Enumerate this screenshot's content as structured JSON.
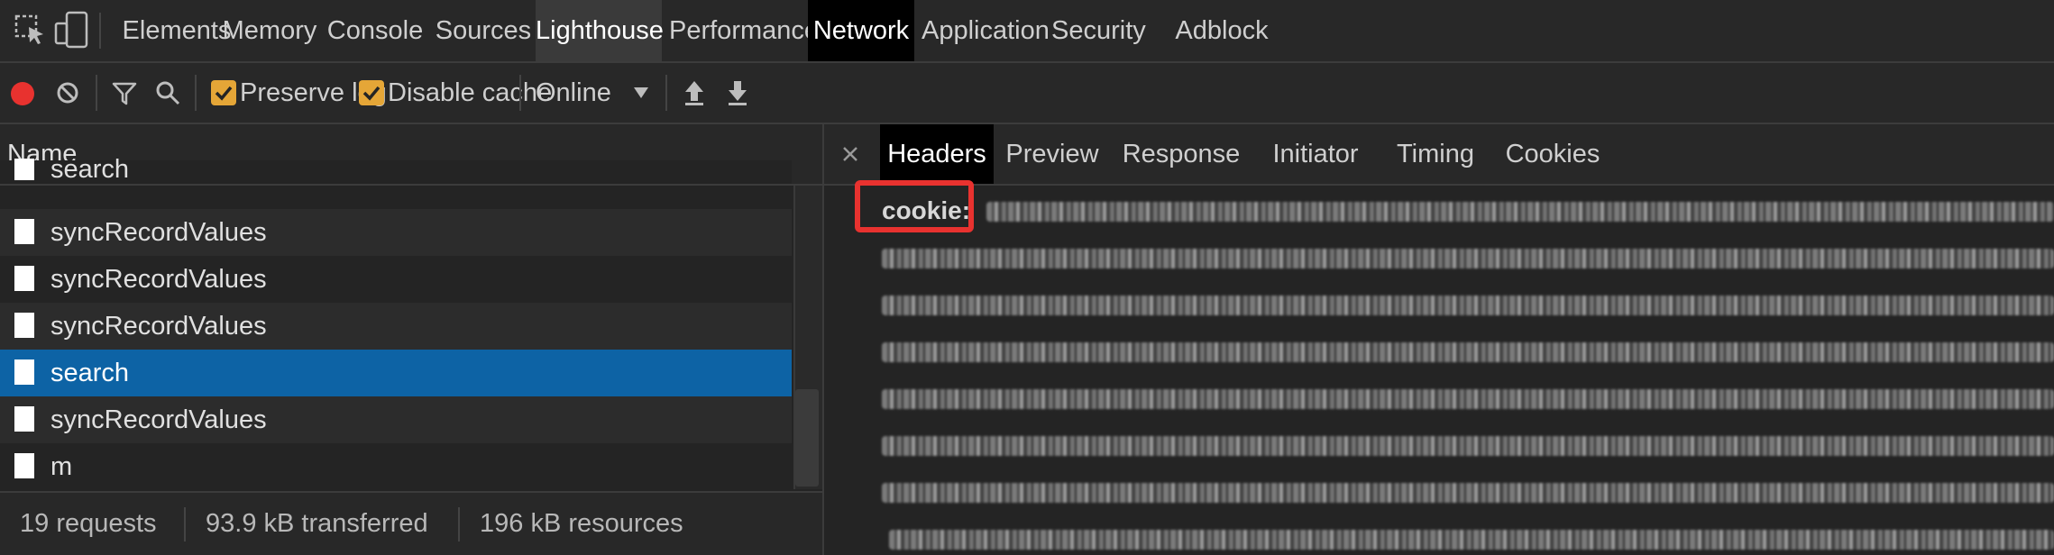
{
  "top_tabs": [
    "Elements",
    "Memory",
    "Console",
    "Sources",
    "Lighthouse",
    "Performance",
    "Network",
    "Application",
    "Security",
    "Adblock Plus"
  ],
  "toolbar": {
    "preserve_log": "Preserve log",
    "disable_cache": "Disable cache",
    "throttle": "Online",
    "preserve_log_checked": true,
    "disable_cache_checked": true
  },
  "requests_panel": {
    "header": "Name",
    "rows": [
      "search",
      "syncRecordValues",
      "syncRecordValues",
      "syncRecordValues",
      "search",
      "syncRecordValues",
      "m"
    ],
    "selected_row": 4
  },
  "status": {
    "requests": "19 requests",
    "transferred": "93.9 kB transferred",
    "resources": "196 kB resources"
  },
  "detail_tabs": [
    "Headers",
    "Preview",
    "Response",
    "Initiator",
    "Timing",
    "Cookies"
  ],
  "active_detail_tab": "Headers",
  "headers": {
    "cookie_label": "cookie:"
  },
  "colors": {
    "record": "#e8322f",
    "checkbox": "#e5a637",
    "selected": "#0d63a5",
    "highlight": "#e8322f"
  },
  "icons": [
    "inspect-icon",
    "device-toolbar-icon",
    "record-icon",
    "clear-icon",
    "filter-icon",
    "search-icon",
    "dropdown-icon",
    "upload-icon",
    "download-icon",
    "close-icon",
    "file-icon"
  ]
}
